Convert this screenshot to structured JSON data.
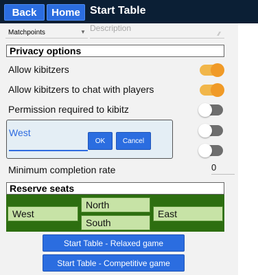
{
  "topbar": {
    "back_label": "Back",
    "home_label": "Home",
    "title": "Start Table"
  },
  "form": {
    "scoring_value": "Matchpoints",
    "description_placeholder": "Description"
  },
  "privacy": {
    "header": "Privacy options",
    "options": [
      {
        "label": "Allow kibitzers",
        "on": true
      },
      {
        "label": "Allow kibitzers to chat with players",
        "on": true
      },
      {
        "label": "Permission required to kibitz",
        "on": false
      }
    ],
    "extra_toggles": [
      {
        "on": false
      },
      {
        "on": false
      }
    ]
  },
  "dialog": {
    "input_value": "West",
    "ok_label": "OK",
    "cancel_label": "Cancel"
  },
  "min_completion": {
    "label": "Minimum completion rate",
    "value": "0"
  },
  "reserve": {
    "header": "Reserve seats",
    "west": "West",
    "north": "North",
    "south": "South",
    "east": "East"
  },
  "actions": {
    "relaxed_label": "Start Table - Relaxed game",
    "competitive_label": "Start Table - Competitive game"
  },
  "colors": {
    "topbar": "#0b1f35",
    "button": "#2b6de0",
    "toggle_on": "#f09a27",
    "toggle_off": "#6e6e6e",
    "seat_bg": "#2d6e10",
    "seat_btn": "#c7e3a6"
  }
}
